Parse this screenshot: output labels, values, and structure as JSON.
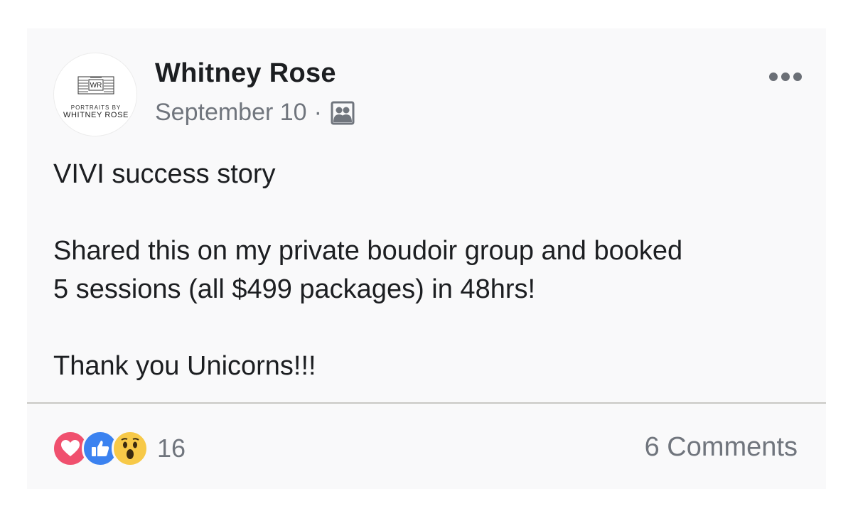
{
  "post": {
    "author": "Whitney Rose",
    "avatar": {
      "monogram": "WR",
      "line1": "PORTRAITS BY",
      "line2": "WHITNEY ROSE"
    },
    "date": "September 10",
    "separator": "·",
    "audience_icon": "group-icon",
    "text_title": "VIVI success story",
    "text_line1": "Shared this on my private boudoir group and booked",
    "text_line2": "5 sessions (all $499 packages) in 48hrs!",
    "text_line3": "Thank you Unicorns!!!",
    "reactions": [
      "love",
      "like",
      "wow"
    ],
    "reaction_count": "16",
    "comments": "6 Comments"
  },
  "colors": {
    "love": "#f0506e",
    "like": "#3b82f0",
    "wow": "#f7c948",
    "text": "#1c1e21",
    "muted": "#70757d"
  }
}
